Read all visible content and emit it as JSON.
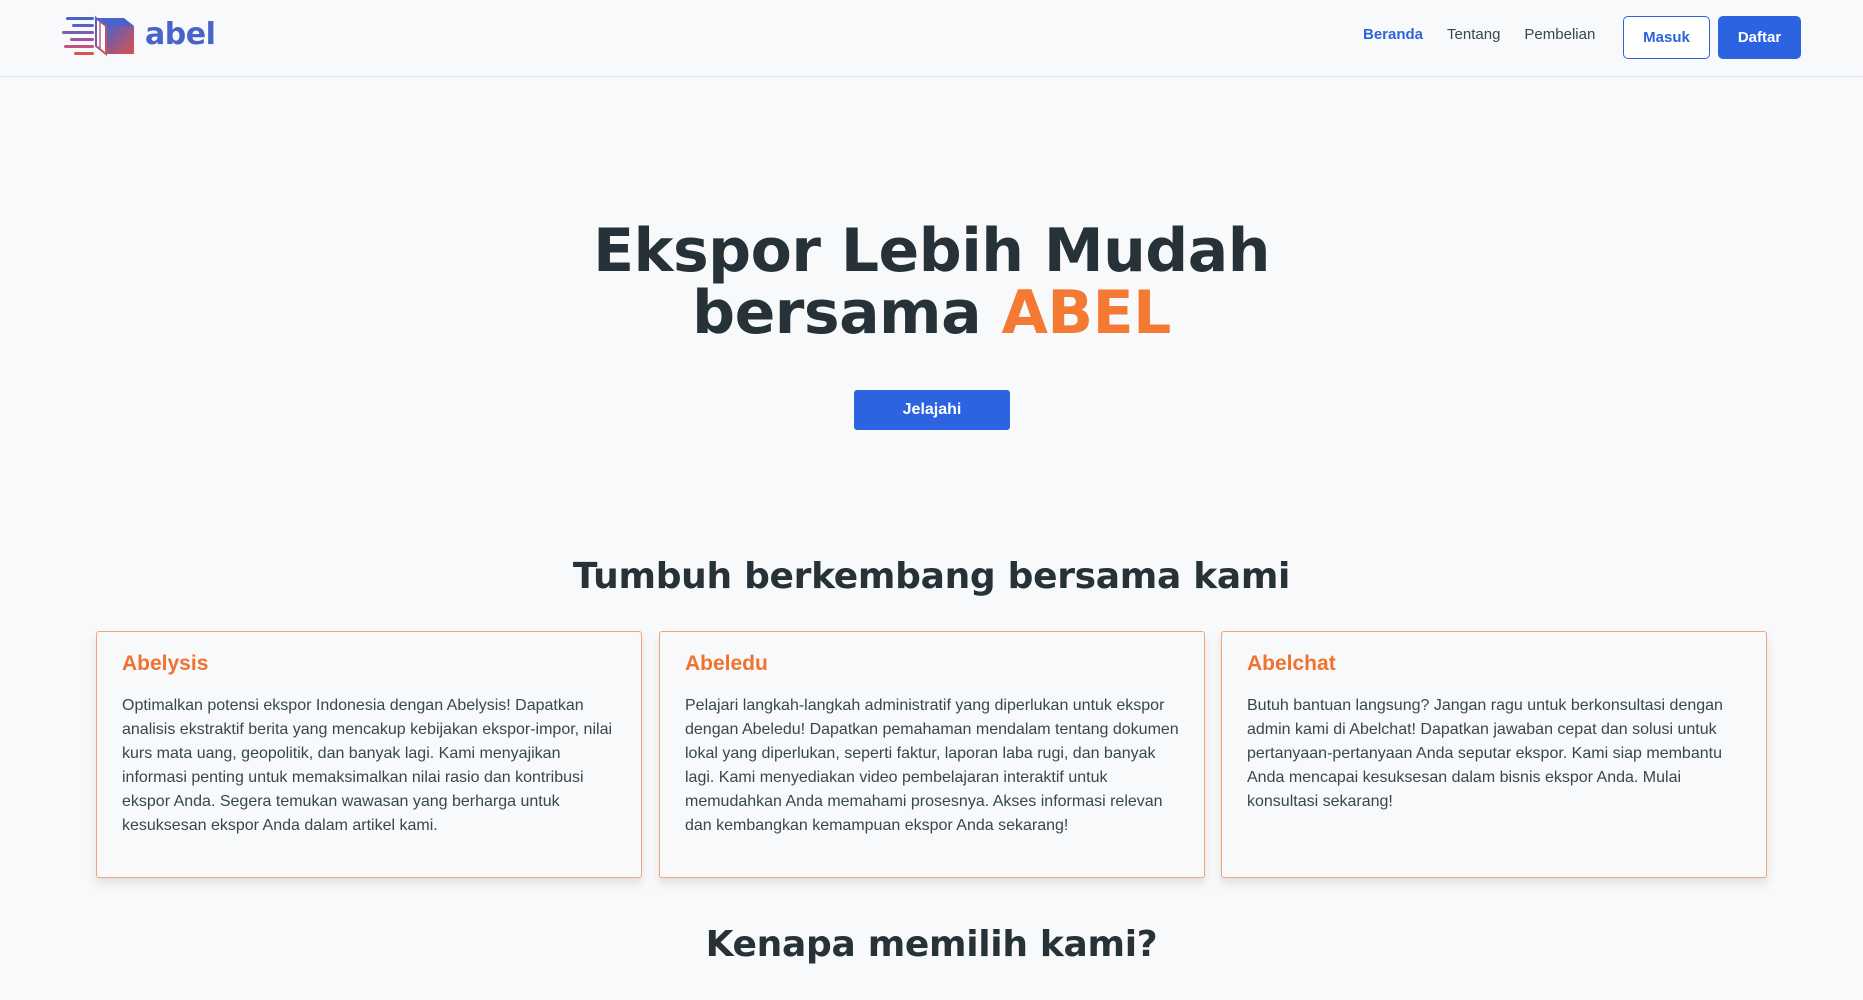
{
  "brand": {
    "name": "abel",
    "colors": {
      "primary": "#2b63e0",
      "accent": "#f47a33",
      "logo_blue": "#4a63c9",
      "logo_red": "#e0504a"
    }
  },
  "nav": {
    "links": [
      {
        "label": "Beranda",
        "active": true
      },
      {
        "label": "Tentang",
        "active": false
      },
      {
        "label": "Pembelian",
        "active": false
      }
    ],
    "login_label": "Masuk",
    "register_label": "Daftar"
  },
  "hero": {
    "title_line1": "Ekspor Lebih Mudah",
    "title_line2_prefix": "bersama ",
    "title_line2_accent": "ABEL",
    "cta_label": "Jelajahi"
  },
  "features": {
    "heading": "Tumbuh berkembang bersama kami",
    "cards": [
      {
        "title": "Abelysis",
        "body": "Optimalkan potensi ekspor Indonesia dengan Abelysis! Dapatkan analisis ekstraktif berita yang mencakup kebijakan ekspor-impor, nilai kurs mata uang, geopolitik, dan banyak lagi. Kami menyajikan informasi penting untuk memaksimalkan nilai rasio dan kontribusi ekspor Anda. Segera temukan wawasan yang berharga untuk kesuksesan ekspor Anda dalam artikel kami."
      },
      {
        "title": "Abeledu",
        "body": "Pelajari langkah-langkah administratif yang diperlukan untuk ekspor dengan Abeledu! Dapatkan pemahaman mendalam tentang dokumen lokal yang diperlukan, seperti faktur, laporan laba rugi, dan banyak lagi. Kami menyediakan video pembelajaran interaktif untuk memudahkan Anda memahami prosesnya. Akses informasi relevan dan kembangkan kemampuan ekspor Anda sekarang!"
      },
      {
        "title": "Abelchat",
        "body": "Butuh bantuan langsung? Jangan ragu untuk berkonsultasi dengan admin kami di Abelchat! Dapatkan jawaban cepat dan solusi untuk pertanyaan-pertanyaan Anda seputar ekspor. Kami siap membantu Anda mencapai kesuksesan dalam bisnis ekspor Anda. Mulai konsultasi sekarang!"
      }
    ]
  },
  "why": {
    "heading": "Kenapa memilih kami?"
  },
  "icons": {
    "logo": "abel-logo-box-icon"
  }
}
